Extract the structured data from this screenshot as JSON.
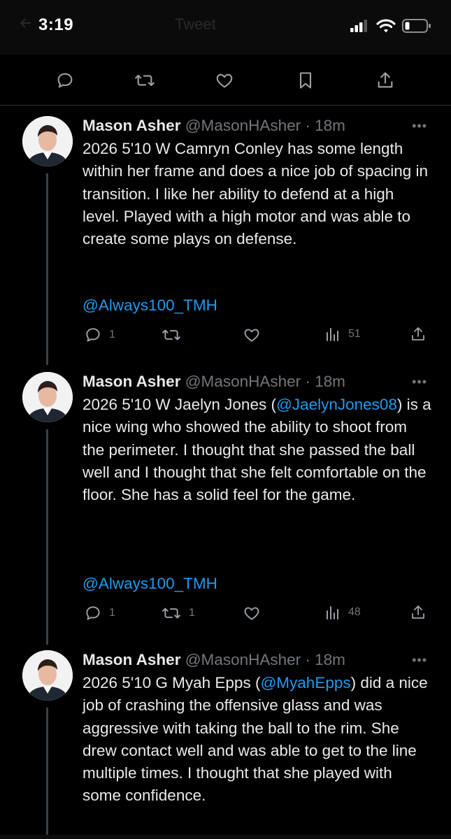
{
  "status_bar": {
    "time": "3:19",
    "ghost_title": "Tweet"
  },
  "top_actions": {
    "icons": [
      "reply-icon",
      "retweet-icon",
      "like-icon",
      "bookmark-icon",
      "share-icon"
    ]
  },
  "tweets": [
    {
      "name": "Mason Asher",
      "handle": "@MasonHAsher",
      "time": "· 18m",
      "more": "•••",
      "body_parts": {
        "text": "2026 5'10 W Camryn Conley has some length within her frame and does a nice job of spacing in transition. I like her ability to defend at a high level. Played with a high motor and was able to create some plays on defense."
      },
      "tag": "@Always100_TMH",
      "replies": "1",
      "retweets": "",
      "likes": "",
      "views": "51"
    },
    {
      "name": "Mason Asher",
      "handle": "@MasonHAsher",
      "time": "· 18m",
      "more": "•••",
      "body_parts": {
        "pre": "2026 5'10 W Jaelyn Jones (",
        "mention": "@JaelynJones08",
        "post": ") is a nice wing who showed the ability to shoot from the perimeter. I thought that she passed the ball well and I thought that she felt comfortable on the floor. She has a solid feel for the game."
      },
      "tag": "@Always100_TMH",
      "replies": "1",
      "retweets": "1",
      "likes": "",
      "views": "48"
    },
    {
      "name": "Mason Asher",
      "handle": "@MasonHAsher",
      "time": "· 18m",
      "more": "•••",
      "body_parts": {
        "pre": "2026 5'10 G Myah Epps (",
        "mention": "@MyahEpps",
        "post": ") did a nice job of crashing the offensive glass and was aggressive with taking the ball to the rim. She drew contact well and was able to get to the line multiple times. I thought that she played with some confidence."
      }
    }
  ],
  "colors": {
    "background": "#000000",
    "text": "#e7e9ea",
    "muted": "#71767b",
    "link": "#1d9bf0"
  }
}
